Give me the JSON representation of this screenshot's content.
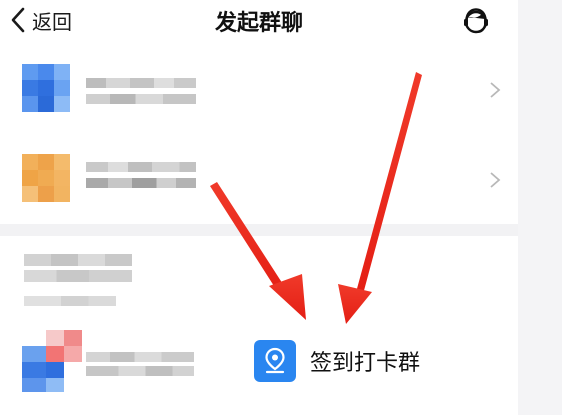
{
  "nav": {
    "back_label": "返回",
    "title": "发起群聊",
    "service_icon": "customer-service-headset-icon"
  },
  "groups": [
    {
      "avatar_color": "#3b7be0",
      "name_blurred": true
    },
    {
      "avatar_color": "#f0a845",
      "name_blurred": true
    }
  ],
  "feature": {
    "label": "签到打卡群",
    "icon": "location-pin-icon",
    "icon_color": "#2a86f0"
  },
  "annotation": {
    "arrow_color": "#f02a1e",
    "arrow_count": 2
  }
}
